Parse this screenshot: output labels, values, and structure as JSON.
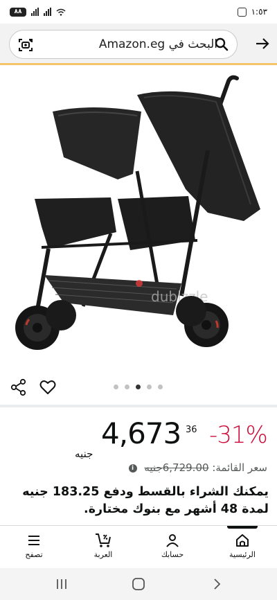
{
  "status_bar": {
    "time": "١:٥٣",
    "battery": "٨٨"
  },
  "search": {
    "text": "البحث في Amazon.eg"
  },
  "product": {
    "image_alt": "double stroller",
    "watermark": "dubizzle",
    "image_count": 5,
    "active_image": 3
  },
  "price": {
    "discount": "-31%",
    "whole": "4,673",
    "fraction": "36",
    "currency": "جنيه",
    "list_price_label": "سعر القائمة:",
    "list_price_value": "6,729.00",
    "list_price_currency": "جنيه"
  },
  "installment": {
    "text": "يمكنك الشراء بالقسط ودفع 183.25 جنيه لمدة 48 أشهر مع بنوك مختارة."
  },
  "bottom_nav": {
    "items": [
      {
        "label": "الرئيسية",
        "icon": "home-icon"
      },
      {
        "label": "حسابك",
        "icon": "person-icon"
      },
      {
        "label": "العربة",
        "icon": "cart-icon"
      },
      {
        "label": "تصفح",
        "icon": "menu-icon"
      }
    ]
  },
  "colors": {
    "discount": "#cc0c39",
    "header_accent": "#f4c469",
    "header_bg": "#f2f2f2"
  }
}
